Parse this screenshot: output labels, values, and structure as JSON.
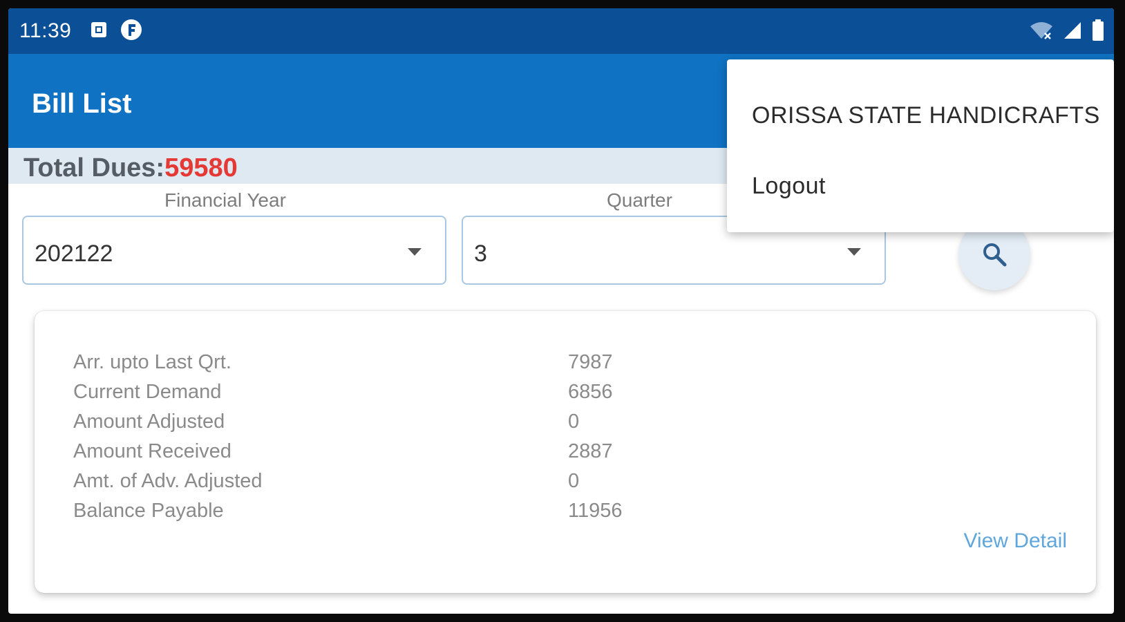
{
  "status_bar": {
    "time": "11:39",
    "icons": [
      "notification-square-icon",
      "app-f-icon",
      "wifi-off-icon",
      "signal-icon",
      "battery-icon"
    ]
  },
  "app_bar": {
    "title": "Bill List"
  },
  "total_dues": {
    "label": "Total Dues:",
    "value": "59580"
  },
  "filters": {
    "financial_year": {
      "caption": "Financial Year",
      "selected": "202122"
    },
    "quarter": {
      "caption": "Quarter",
      "selected": "3"
    }
  },
  "bill_card": {
    "rows": [
      {
        "label": "Arr. upto Last Qrt.",
        "value": "7987"
      },
      {
        "label": "Current Demand",
        "value": "6856"
      },
      {
        "label": "Amount Adjusted",
        "value": "0"
      },
      {
        "label": "Amount Received",
        "value": "2887"
      },
      {
        "label": "Amt. of Adv. Adjusted",
        "value": "0"
      },
      {
        "label": "Balance Payable",
        "value": "11956"
      }
    ],
    "view_detail": "View Detail"
  },
  "overflow_menu": {
    "items": [
      "ORISSA STATE HANDICRAFTS",
      "Logout"
    ]
  },
  "colors": {
    "status_bar": "#0b4f96",
    "app_bar": "#0f72c2",
    "dues_value": "#e53935",
    "link": "#5fa6dc"
  }
}
